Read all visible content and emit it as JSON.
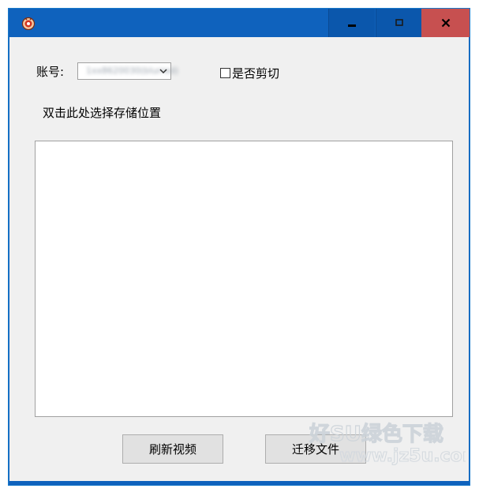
{
  "window": {
    "colors": {
      "titlebar": "#0f62bd",
      "close": "#c75050",
      "client": "#f0f0f0"
    },
    "icons": {
      "app": "app-logo-icon",
      "min": "minimize-icon",
      "max": "maximize-icon",
      "close": "close-icon"
    }
  },
  "form": {
    "account_label": "账号:",
    "account_value": "1xx8620030(blurred)",
    "cut_label": "是否剪切",
    "cut_checked": false,
    "storage_label": "双击此处选择存储位置"
  },
  "buttons": {
    "refresh": "刷新视频",
    "migrate": "迁移文件"
  }
}
